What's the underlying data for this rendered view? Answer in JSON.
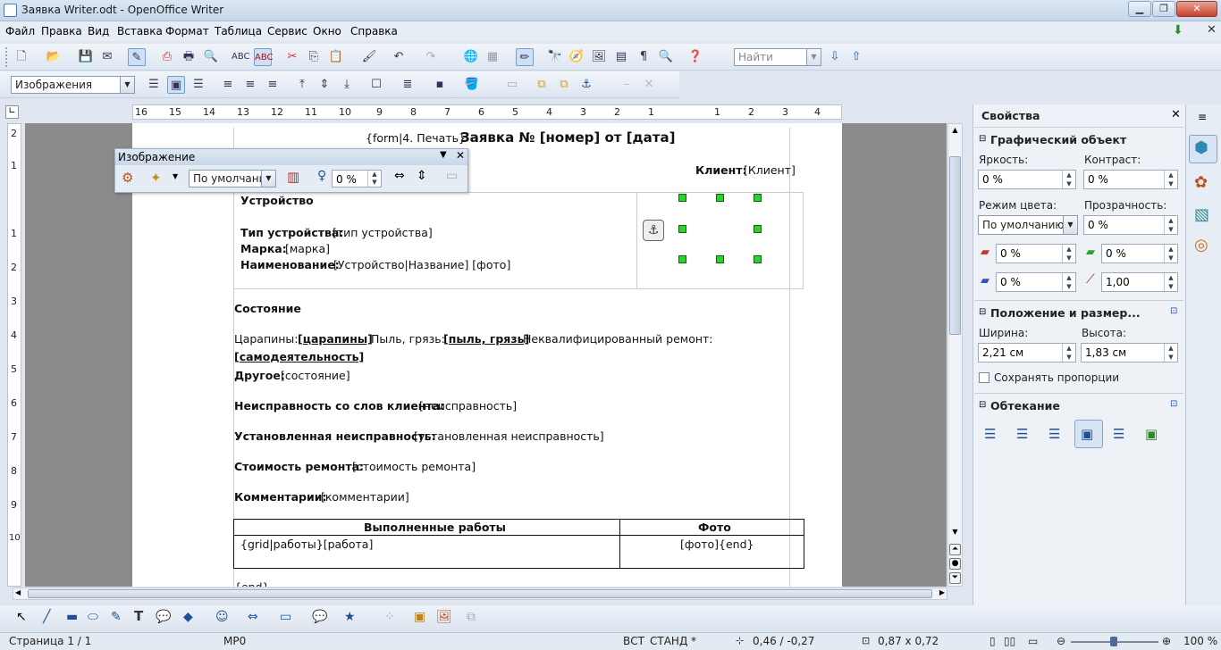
{
  "window": {
    "title": "Заявка Writer.odt - OpenOffice Writer",
    "min": "▁",
    "max": "❐",
    "close": "✕"
  },
  "menu": [
    "Файл",
    "Правка",
    "Вид",
    "Вставка",
    "Формат",
    "Таблица",
    "Сервис",
    "Окно",
    "Справка"
  ],
  "toolbar": {
    "find_placeholder": "Найти",
    "style_value": "Изображения"
  },
  "ruler": {
    "h_ticks": [
      "16",
      "15",
      "14",
      "13",
      "12",
      "11",
      "10",
      "9",
      "8",
      "7",
      "6",
      "5",
      "4",
      "3",
      "2",
      "1",
      "1",
      "2",
      "3",
      "4"
    ],
    "v_ticks": [
      "2",
      "1",
      "1",
      "2",
      "3",
      "4",
      "5",
      "6",
      "7",
      "8",
      "9",
      "10"
    ]
  },
  "float_toolbar": {
    "title": "Изображение",
    "filter_value": "По умолчанию",
    "transparency_value": "0 %"
  },
  "document": {
    "header_prefix": "{form|4. Печать}",
    "header_title": "Заявка № [номер] от [дата]",
    "client_label": "Клиент:",
    "client_value": "[Клиент]",
    "device_heading": "Устройство",
    "device_type_label": "Тип устройства:",
    "device_type_value": "[тип устройства]",
    "brand_label": "Марка:",
    "brand_value": "[марка]",
    "name_label": "Наименование:",
    "name_value": "[Устройство|Название] [фото]",
    "state_heading": "Состояние",
    "scratches_label": "Царапины:",
    "scratches_value": "[царапины]",
    "dust_label": "Пыль, грязь:",
    "dust_value": "[пыль, грязь]",
    "repair_label": "Неквалифицированный ремонт:",
    "repair_value": "[самодеятельность]",
    "other_label": "Другое:",
    "other_value": "[состояние]",
    "fault_client_label": "Неисправность со слов клиента:",
    "fault_client_value": "[неисправность]",
    "fault_found_label": "Установленная неисправность:",
    "fault_found_value": "[установленная неисправность]",
    "cost_label": "Стоимость ремонта:",
    "cost_value": "[стоимость ремонта]",
    "comments_label": "Комментарии:",
    "comments_value": "[комментарии]",
    "works_table": {
      "headers": [
        "Выполненные работы",
        "Фото"
      ],
      "row": [
        "{grid|работы}[работа]",
        "[фото]{end}"
      ]
    },
    "tail_text": "{end}"
  },
  "sidebar": {
    "title": "Свойства",
    "section_graphic": "Графический объект",
    "brightness_label": "Яркость:",
    "brightness_value": "0 %",
    "contrast_label": "Контраст:",
    "contrast_value": "0 %",
    "color_mode_label": "Режим цвета:",
    "color_mode_value": "По умолчанию",
    "transparency_label": "Прозрачность:",
    "transparency_value": "0 %",
    "red_value": "0 %",
    "green_value": "0 %",
    "blue_value": "0 %",
    "gamma_value": "1,00",
    "section_position": "Положение и размер...",
    "width_label": "Ширина:",
    "width_value": "2,21 см",
    "height_label": "Высота:",
    "height_value": "1,83 см",
    "keep_ratio_label": "Сохранять пропорции",
    "section_wrap": "Обтекание"
  },
  "status": {
    "page": "Страница 1 / 1",
    "language": "МР0",
    "insert_mode": "ВСТ",
    "selection_mode": "СТАНД",
    "modified": "*",
    "position": "0,46 / -0,27",
    "size": "0,87 x 0,72",
    "zoom": "100 %"
  }
}
